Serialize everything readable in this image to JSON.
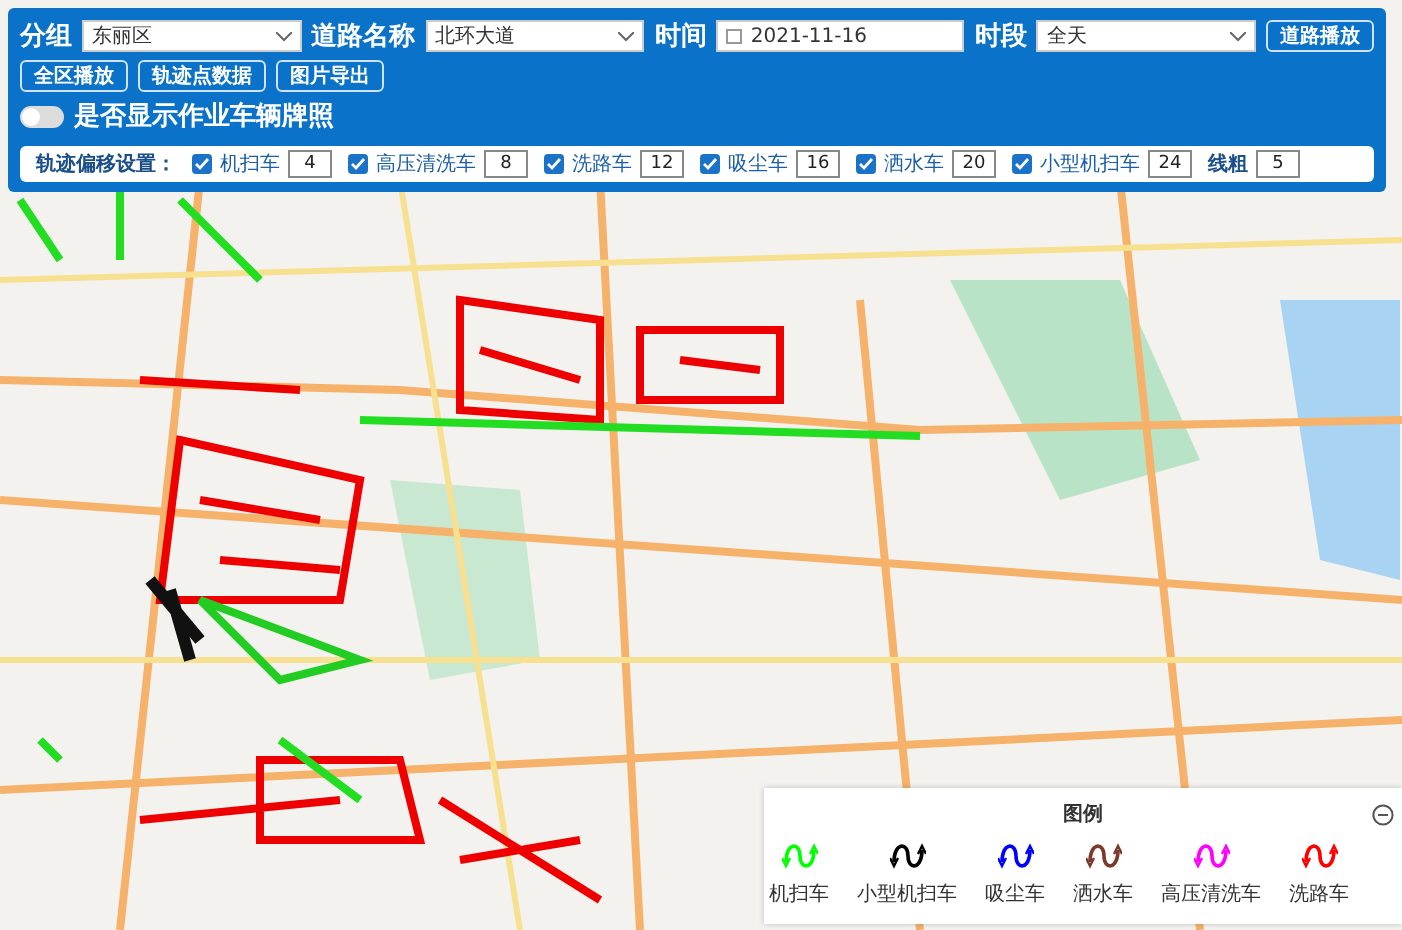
{
  "toolbar": {
    "fields": [
      {
        "label": "分组",
        "value": "东丽区",
        "kind": "select"
      },
      {
        "label": "道路名称",
        "value": "北环大道",
        "kind": "select"
      },
      {
        "label": "时间",
        "value": "2021-11-16",
        "kind": "date"
      },
      {
        "label": "时段",
        "value": "全天",
        "kind": "select"
      }
    ],
    "play_button": "道路播放",
    "buttons": [
      "全区播放",
      "轨迹点数据",
      "图片导出"
    ],
    "toggle": {
      "label": "是否显示作业车辆牌照",
      "on": false
    }
  },
  "offsets": {
    "label": "轨迹偏移设置：",
    "items": [
      {
        "label": "机扫车",
        "checked": true,
        "value": "4"
      },
      {
        "label": "高压清洗车",
        "checked": true,
        "value": "8"
      },
      {
        "label": "洗路车",
        "checked": true,
        "value": "12"
      },
      {
        "label": "吸尘车",
        "checked": true,
        "value": "16"
      },
      {
        "label": "洒水车",
        "checked": true,
        "value": "20"
      },
      {
        "label": "小型机扫车",
        "checked": true,
        "value": "24"
      }
    ],
    "line_width": {
      "label": "线粗",
      "value": "5"
    }
  },
  "legend": {
    "title": "图例",
    "items": [
      {
        "label": "机扫车",
        "color": "#00ff00"
      },
      {
        "label": "小型机扫车",
        "color": "#000000"
      },
      {
        "label": "吸尘车",
        "color": "#0000ff"
      },
      {
        "label": "洒水车",
        "color": "#7a3b2e"
      },
      {
        "label": "高压清洗车",
        "color": "#ff00ff"
      },
      {
        "label": "洗路车",
        "color": "#ff0000"
      }
    ]
  }
}
